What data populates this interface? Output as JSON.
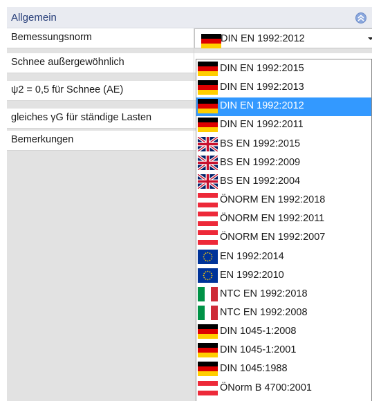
{
  "header": {
    "title": "Allgemein"
  },
  "properties": [
    {
      "label": "Bemessungsnorm"
    },
    {
      "label": "Schnee außergewöhnlich"
    },
    {
      "label": " ψ2 = 0,5 für Schnee (AE)"
    },
    {
      "label": "gleiches γG für ständige Lasten"
    },
    {
      "label": "Bemerkungen"
    }
  ],
  "combo": {
    "value": "DIN EN 1992:2012",
    "flag": "germany-flag"
  },
  "dropdown": {
    "selected_index": 2,
    "items": [
      {
        "label": "DIN EN 1992:2015",
        "flag": "germany-flag"
      },
      {
        "label": "DIN EN 1992:2013",
        "flag": "germany-flag"
      },
      {
        "label": "DIN EN 1992:2012",
        "flag": "germany-flag"
      },
      {
        "label": "DIN EN 1992:2011",
        "flag": "germany-flag"
      },
      {
        "label": "BS EN 1992:2015",
        "flag": "uk-flag"
      },
      {
        "label": "BS EN 1992:2009",
        "flag": "uk-flag"
      },
      {
        "label": "BS EN 1992:2004",
        "flag": "uk-flag"
      },
      {
        "label": "ÖNORM EN 1992:2018",
        "flag": "austria-flag"
      },
      {
        "label": "ÖNORM EN 1992:2011",
        "flag": "austria-flag"
      },
      {
        "label": "ÖNORM EN 1992:2007",
        "flag": "austria-flag"
      },
      {
        "label": "EN 1992:2014",
        "flag": "eu-flag"
      },
      {
        "label": "EN 1992:2010",
        "flag": "eu-flag"
      },
      {
        "label": "NTC EN 1992:2018",
        "flag": "italy-flag"
      },
      {
        "label": "NTC EN 1992:2008",
        "flag": "italy-flag"
      },
      {
        "label": "DIN 1045-1:2008",
        "flag": "germany-flag"
      },
      {
        "label": "DIN 1045-1:2001",
        "flag": "germany-flag"
      },
      {
        "label": "DIN 1045:1988",
        "flag": "germany-flag"
      },
      {
        "label": "ÖNorm B 4700:2001",
        "flag": "austria-flag"
      }
    ]
  },
  "colors": {
    "header_bg": "#e9ebf1",
    "header_text": "#283f7a",
    "selection": "#3399ff",
    "grid_bg": "#e2e2e2"
  }
}
